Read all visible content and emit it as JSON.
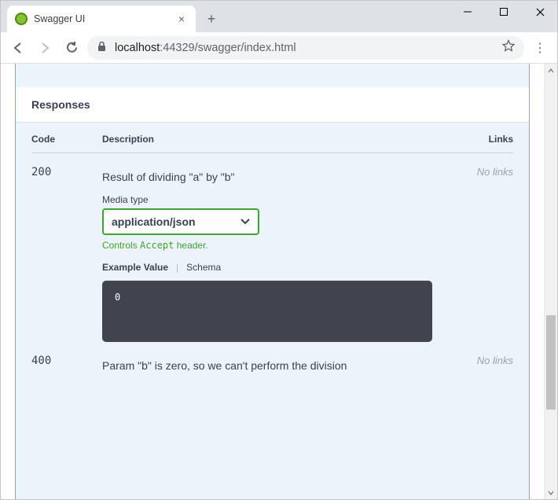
{
  "browser": {
    "tab_title": "Swagger UI",
    "url_host": "localhost",
    "url_port": ":44329",
    "url_path": "/swagger/index.html",
    "new_tab_glyph": "+",
    "close_tab_glyph": "×"
  },
  "responses": {
    "heading": "Responses",
    "cols": {
      "code": "Code",
      "desc": "Description",
      "links": "Links"
    },
    "media_label": "Media type",
    "media_value": "application/json",
    "media_hint_prefix": "Controls ",
    "media_hint_code": "Accept",
    "media_hint_suffix": " header.",
    "ev_label": "Example Value",
    "schema_label": "Schema",
    "example_body": "0",
    "rows": [
      {
        "code": "200",
        "desc": "Result of dividing \"a\" by \"b\"",
        "links": "No links"
      },
      {
        "code": "400",
        "desc": "Param \"b\" is zero, so we can't perform the division",
        "links": "No links"
      }
    ]
  }
}
